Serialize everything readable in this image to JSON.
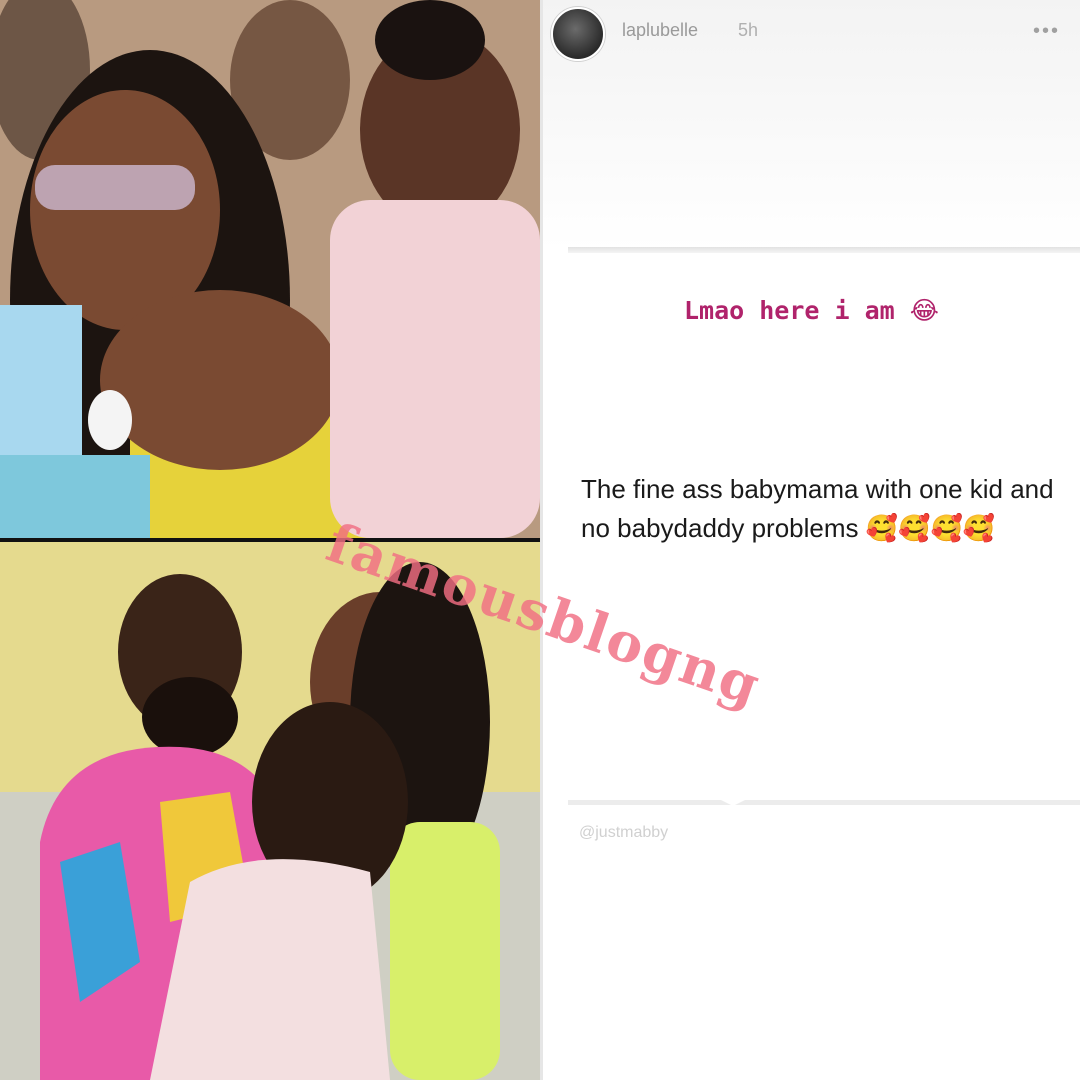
{
  "story": {
    "username": "laplubelle",
    "time": "5h",
    "more_icon": "more-options-icon",
    "caption": "Lmao here i am",
    "caption_emoji": "😂",
    "body_text": "The fine ass babymama with one kid and no babydaddy problems",
    "body_emojis": "🥰🥰🥰🥰",
    "mention": "@justmabby"
  },
  "watermark": "famousblogng",
  "colors": {
    "caption": "#b0236b",
    "watermark": "#f06e82",
    "body_text": "#1a1a1a"
  }
}
